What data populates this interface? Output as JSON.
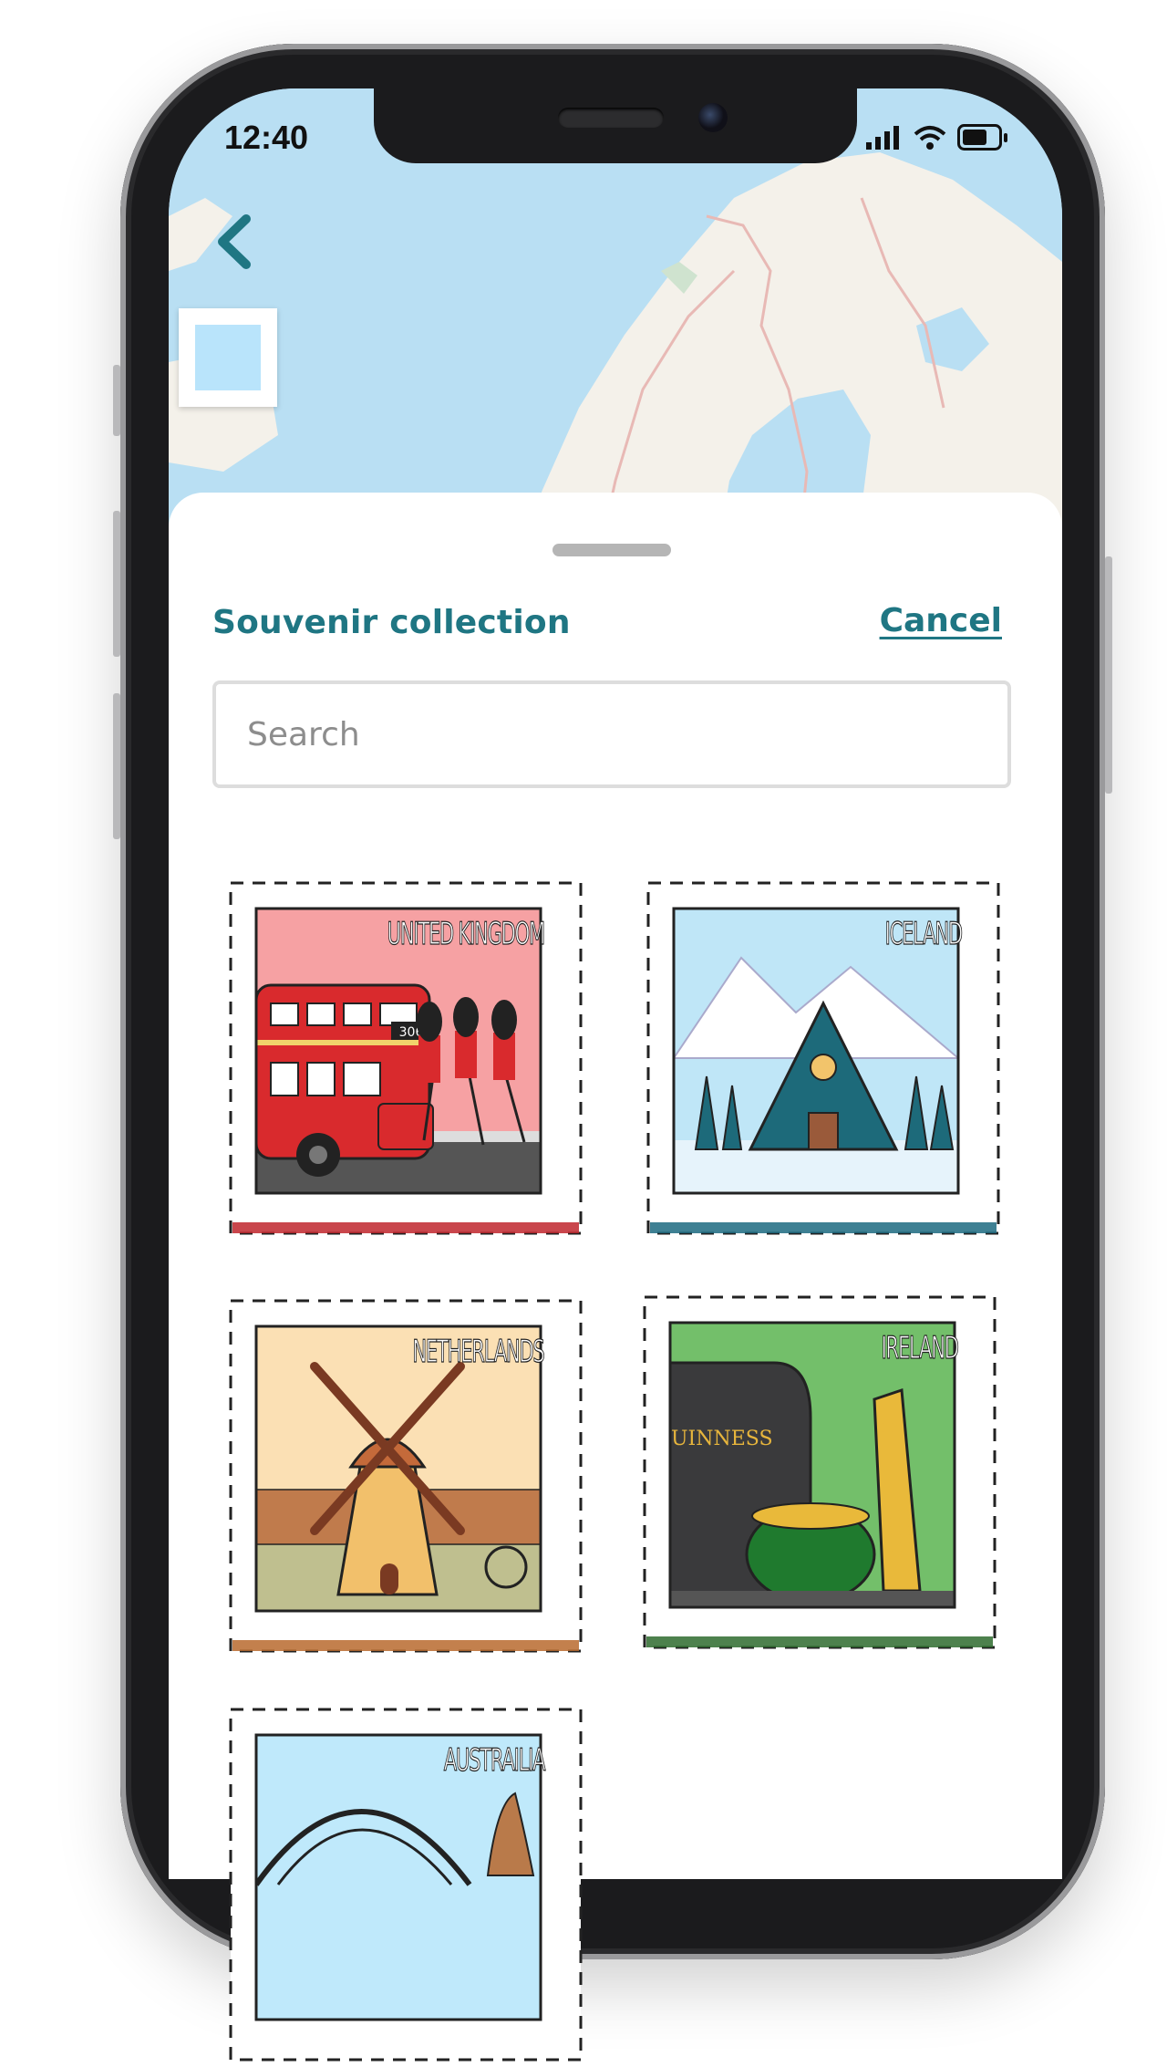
{
  "status_bar": {
    "time": "12:40"
  },
  "sheet": {
    "title": "Souvenir collection",
    "cancel_label": "Cancel",
    "search": {
      "placeholder": "Search",
      "value": ""
    }
  },
  "stamps": [
    {
      "label": "UNITED KINGDOM",
      "theme_color": "#c0262d"
    },
    {
      "label": "ICELAND",
      "theme_color": "#1c6a80"
    },
    {
      "label": "NETHERLANDS",
      "theme_color": "#b86a2e"
    },
    {
      "label": "IRELAND",
      "theme_color": "#2e6b2e"
    },
    {
      "label": "AUSTRAILIA",
      "theme_color": "#5a3a22"
    }
  ],
  "bus_number": "306",
  "guinness_text": "GUINNESS",
  "colors": {
    "accent": "#1f7683",
    "map_water": "#b9dff3",
    "map_land": "#f4f1ea"
  }
}
